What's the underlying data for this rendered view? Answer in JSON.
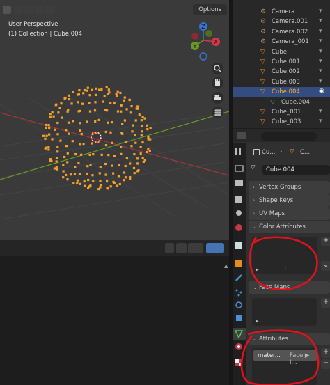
{
  "viewport": {
    "options_label": "Options",
    "view_name": "User Perspective",
    "collection_info": "(1) Collection | Cube.004",
    "gizmo": {
      "x": "X",
      "y": "Y",
      "z": "Z"
    }
  },
  "outliner": {
    "rows": [
      {
        "label": "Camera"
      },
      {
        "label": "Camera.001"
      },
      {
        "label": "Camera.002"
      },
      {
        "label": "Camera_001"
      },
      {
        "label": "Cube"
      },
      {
        "label": "Cube.001"
      },
      {
        "label": "Cube.002"
      },
      {
        "label": "Cube.003"
      },
      {
        "label": "Cube.004"
      },
      {
        "label": "Cube.004"
      },
      {
        "label": "Cube_001"
      },
      {
        "label": "Cube_003"
      }
    ]
  },
  "properties": {
    "breadcrumb_object": "Cu...",
    "breadcrumb_data": "C...",
    "mesh_name": "Cube.004",
    "panels": {
      "vertex_groups": "Vertex Groups",
      "shape_keys": "Shape Keys",
      "uv_maps": "UV Maps",
      "color_attributes": "Color Attributes",
      "face_maps": "Face Maps",
      "attributes": "Attributes"
    },
    "attribute_item": {
      "name": "mater...",
      "domain": "Face ▶ I..."
    },
    "add_label": "+",
    "remove_label": "−"
  },
  "colors": {
    "viewport_bg": "#3a3a3a",
    "selected_row": "#334d80",
    "highlight_text": "#ffaf29",
    "vertex_orange": "#f5a02a",
    "annotation_red": "#e0121c",
    "axis_x": "#a1363f",
    "axis_y": "#6a9a22"
  }
}
